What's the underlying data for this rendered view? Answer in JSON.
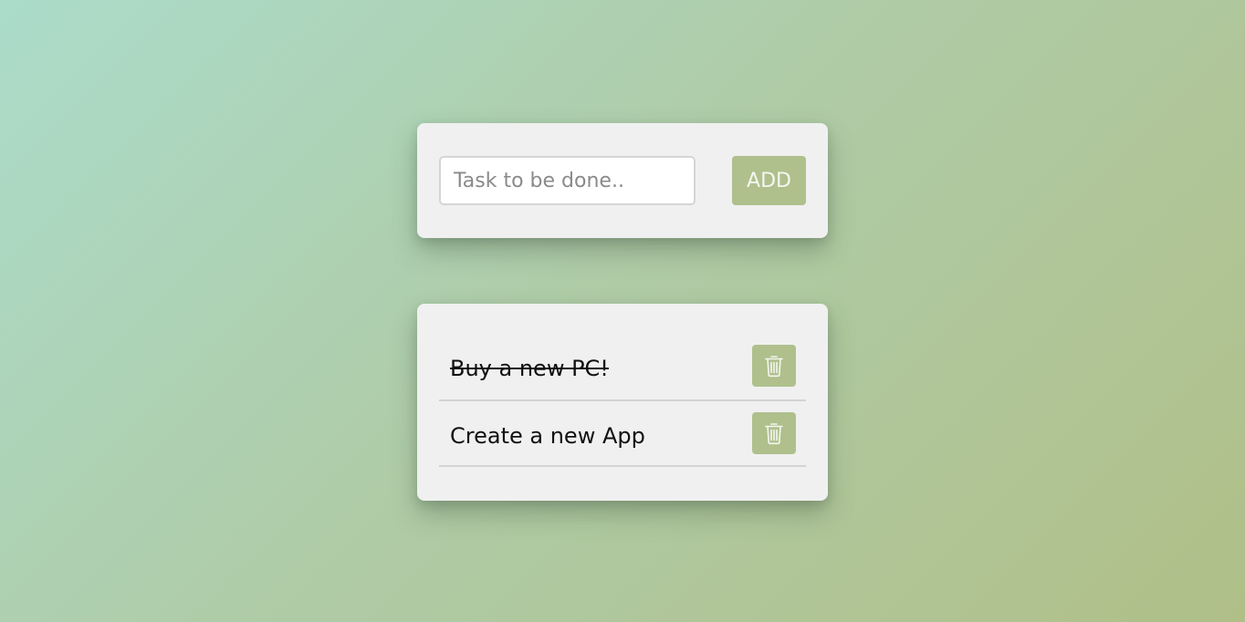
{
  "input_card": {
    "input_placeholder": "Task to be done..",
    "input_value": "",
    "add_label": "ADD"
  },
  "todos": [
    {
      "text": "Buy a new PC!",
      "completed": true
    },
    {
      "text": "Create a new App",
      "completed": false
    }
  ],
  "icons": {
    "delete": "trash-icon"
  },
  "colors": {
    "accent": "#afc08c",
    "card": "#f0f0f0",
    "background_start": "#abdcca",
    "background_end": "#b0bf88"
  }
}
